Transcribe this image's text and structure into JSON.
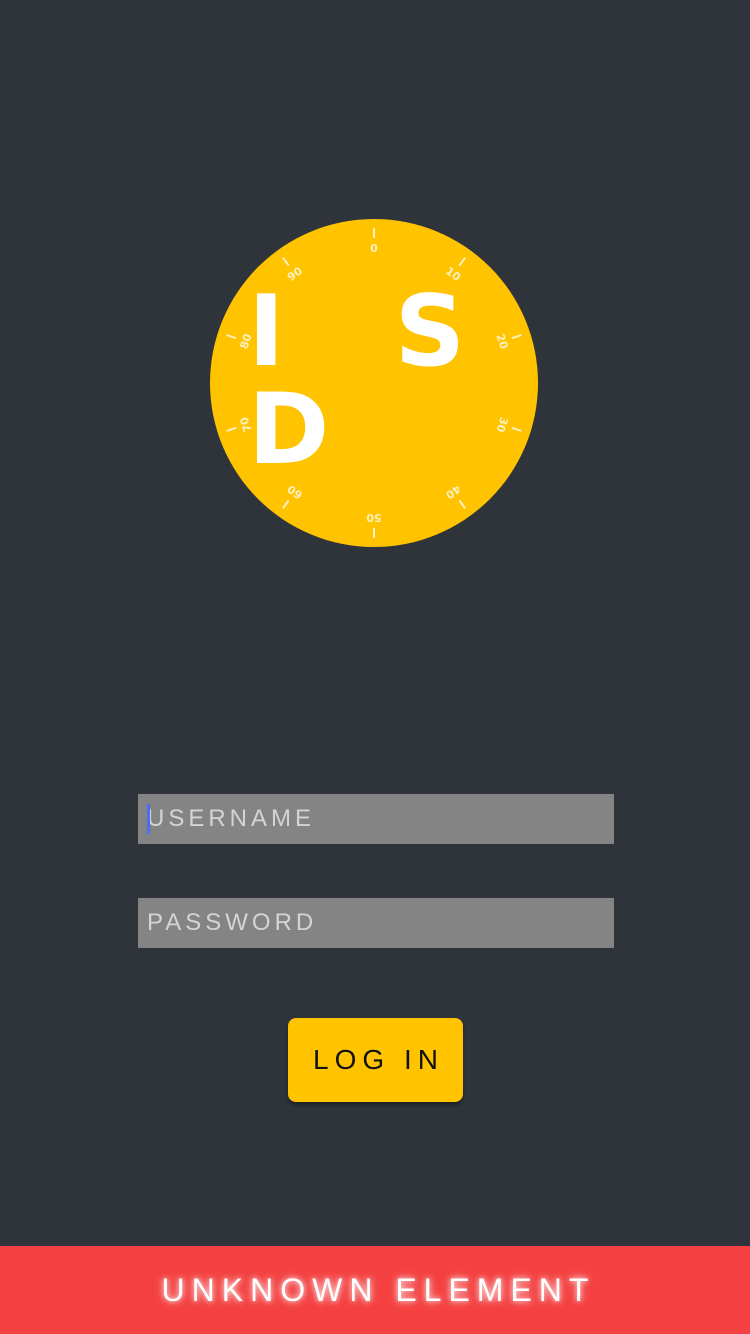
{
  "logo": {
    "text": "I S D",
    "dial_numbers": [
      "0",
      "10",
      "20",
      "30",
      "40",
      "50",
      "60",
      "70",
      "80",
      "90"
    ]
  },
  "login_form": {
    "username_placeholder": "USERNAME",
    "username_value": "",
    "password_placeholder": "PASSWORD",
    "password_value": "",
    "login_label": "LOG IN"
  },
  "banner": {
    "text": "UNKNOWN ELEMENT"
  },
  "colors": {
    "background": "#2e3439",
    "accent": "#ffc300",
    "input_background": "#848484",
    "banner": "#f44040"
  }
}
